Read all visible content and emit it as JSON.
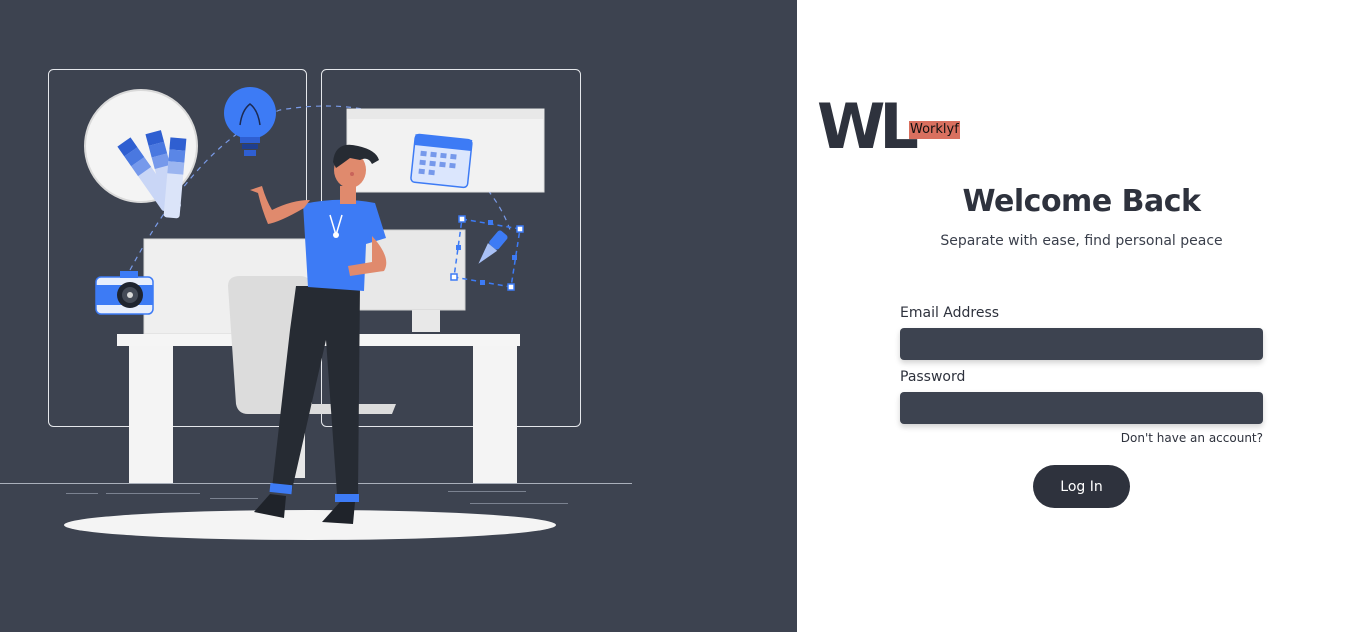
{
  "brand": {
    "mark": "WL",
    "name": "Worklyf"
  },
  "heading": "Welcome Back",
  "subheading": "Separate with ease, find personal peace",
  "form": {
    "email_label": "Email Address",
    "email_value": "",
    "password_label": "Password",
    "password_value": "",
    "signup_link": "Don't have an account?",
    "submit_label": "Log In"
  },
  "colors": {
    "left_panel_bg": "#3d4350",
    "input_bg": "#3d4350",
    "button_bg": "#2e323d",
    "accent_blue": "#3d7bf5",
    "brand_highlight": "#d9705f"
  },
  "illustration": {
    "description_icons": [
      "lightbulb-icon",
      "color-swatch-icon",
      "calendar-icon",
      "camera-icon",
      "pen-tool-icon"
    ]
  }
}
